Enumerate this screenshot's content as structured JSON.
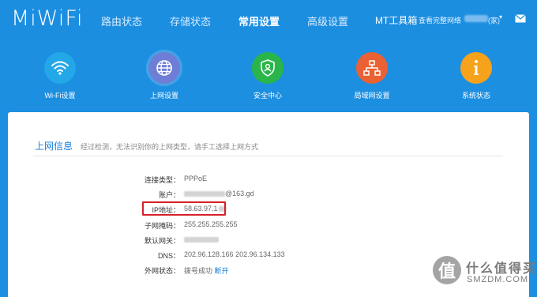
{
  "brand": {
    "logo": "MiWiFi"
  },
  "nav": {
    "items": [
      {
        "label": "路由状态",
        "active": false
      },
      {
        "label": "存储状态",
        "active": false
      },
      {
        "label": "常用设置",
        "active": true
      },
      {
        "label": "高级设置",
        "active": false
      }
    ],
    "toolbox": "MT工具箱",
    "full_network": "查看完整网络",
    "user_suffix": "(家)",
    "caret": "▾"
  },
  "features": [
    {
      "label": "Wi-Fi设置",
      "icon": "wifi-icon",
      "color": "#23a7e8"
    },
    {
      "label": "上网设置",
      "icon": "globe-icon",
      "color": "#6e7ed6"
    },
    {
      "label": "安全中心",
      "icon": "shield-icon",
      "color": "#2ab54a"
    },
    {
      "label": "局域网设置",
      "icon": "network-icon",
      "color": "#ea6133"
    },
    {
      "label": "系统状态",
      "icon": "info-icon",
      "color": "#f7a21b"
    }
  ],
  "panel": {
    "title": "上网信息",
    "description": "经过检测，无法识别你的上网类型，请手工选择上网方式",
    "rows": {
      "conn_type": {
        "label": "连接类型：",
        "value": "PPPoE"
      },
      "account": {
        "label": "账户：",
        "value_suffix": "@163.gd"
      },
      "ip": {
        "label": "IP地址：",
        "value": "58.63.97.1"
      },
      "mask": {
        "label": "子网掩码：",
        "value": "255.255.255.255"
      },
      "gateway": {
        "label": "默认网关："
      },
      "dns": {
        "label": "DNS：",
        "value": "202.96.128.166 202.96.134.133"
      },
      "wan": {
        "label": "外网状态：",
        "value": "拨号成功",
        "action": "断开"
      }
    }
  },
  "watermark": {
    "badge": "值",
    "line1": "什么值得买",
    "line2": "SMZDM.COM"
  }
}
